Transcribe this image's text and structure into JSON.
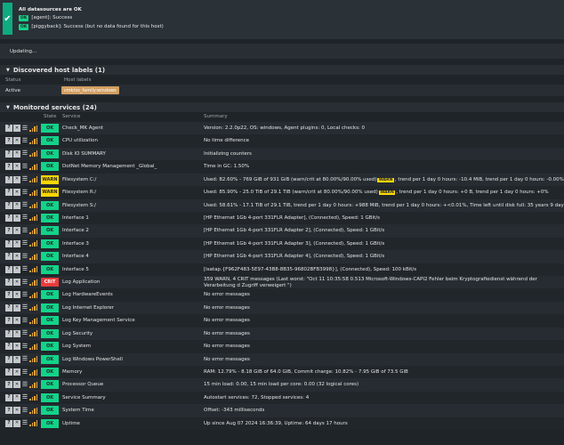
{
  "status": {
    "title": "All datasources are OK",
    "lines": [
      {
        "badge": "OK",
        "text": "[agent]: Success"
      },
      {
        "badge": "OK",
        "text": "[piggyback]: Success (but no data found for this host)"
      }
    ]
  },
  "updating": "Updating...",
  "host_labels": {
    "header": "Discovered host labels (1)",
    "col_status": "Status",
    "col_labels": "Host labels",
    "active": "Active",
    "label": "cmk/os_family:windows"
  },
  "services": {
    "header": "Monitored services (24)",
    "col_state": "State",
    "col_service": "Service",
    "col_summary": "Summary",
    "rows": [
      {
        "state": "OK",
        "name": "Check_MK Agent",
        "summary": "Version: 2.2.0p22, OS: windows, Agent plugins: 0, Local checks: 0"
      },
      {
        "state": "OK",
        "name": "CPU utilization",
        "summary": "No time difference"
      },
      {
        "state": "OK",
        "name": "Disk IO SUMMARY",
        "summary": "Initializing counters"
      },
      {
        "state": "OK",
        "name": "DotNet Memory Management _Global_",
        "summary": "Time in GC: 1.50%"
      },
      {
        "state": "WARN",
        "name": "Filesystem C:/",
        "summary_a": "Used: 82.60% - 769 GiB of 931 GiB (warn/crit at 80.00%/90.00% used)",
        "inline": "WARN",
        "summary_b": ", trend per 1 day 0 hours: -10.4 MiB, trend per 1 day 0 hours: -0.00%"
      },
      {
        "state": "WARN",
        "name": "Filesystem R:/",
        "summary_a": "Used: 85.90% - 25.0 TiB of 29.1 TiB (warn/crit at 80.00%/90.00% used)",
        "inline": "WARN",
        "summary_b": ", trend per 1 day 0 hours: +0 B, trend per 1 day 0 hours: +0%"
      },
      {
        "state": "OK",
        "name": "Filesystem S:/",
        "summary": "Used: 58.61% - 17.1 TiB of 29.1 TiB, trend per 1 day 0 hours: +988 MiB, trend per 1 day 0 hours: +<0.01%, Time left until disk full: 35 years 9 days"
      },
      {
        "state": "OK",
        "name": "Interface 1",
        "summary": "[HP Ethernet 1Gb 4-port 331FLR Adapter], (Connected), Speed: 1 GBit/s"
      },
      {
        "state": "OK",
        "name": "Interface 2",
        "summary": "[HP Ethernet 1Gb 4-port 331FLR Adapter 2], (Connected), Speed: 1 GBit/s"
      },
      {
        "state": "OK",
        "name": "Interface 3",
        "summary": "[HP Ethernet 1Gb 4-port 331FLR Adapter 3], (Connected), Speed: 1 GBit/s"
      },
      {
        "state": "OK",
        "name": "Interface 4",
        "summary": "[HP Ethernet 1Gb 4-port 331FLR Adapter 4], (Connected), Speed: 1 GBit/s"
      },
      {
        "state": "OK",
        "name": "Interface 5",
        "summary": "[isatap.{F962F483-5E97-43B8-8B35-96802BFB3998}], (Connected), Speed: 100 kBit/s"
      },
      {
        "state": "CRIT",
        "name": "Log Application",
        "summary": "359 WARN, 4 CRIT messages (Last worst: \"Oct 11 10:35:58 0.513 Microsoft-Windows-CAPI2 Fehler beim Kryptografiedienst während der Verarbeitung d Zugriff verweigert \")",
        "two_line": true
      },
      {
        "state": "OK",
        "name": "Log HardwareEvents",
        "summary": "No error messages"
      },
      {
        "state": "OK",
        "name": "Log Internet Explorer",
        "summary": "No error messages"
      },
      {
        "state": "OK",
        "name": "Log Key Management Service",
        "summary": "No error messages"
      },
      {
        "state": "OK",
        "name": "Log Security",
        "summary": "No error messages"
      },
      {
        "state": "OK",
        "name": "Log System",
        "summary": "No error messages"
      },
      {
        "state": "OK",
        "name": "Log Windows PowerShell",
        "summary": "No error messages"
      },
      {
        "state": "OK",
        "name": "Memory",
        "summary": "RAM: 12.79% - 8.18 GiB of 64.0 GiB, Commit charge: 10.82% - 7.95 GiB of 73.5 GiB"
      },
      {
        "state": "OK",
        "name": "Processor Queue",
        "summary": "15 min load: 0.00, 15 min load per core: 0.00 (32 logical cores)"
      },
      {
        "state": "OK",
        "name": "Service Summary",
        "summary": "Autostart services: 72, Stopped services: 4"
      },
      {
        "state": "OK",
        "name": "System Time",
        "summary": "Offset: -343 milliseconds"
      },
      {
        "state": "OK",
        "name": "Uptime",
        "summary": "Up since Aug 07 2024 16:36:39, Uptime: 64 days 17 hours"
      }
    ]
  },
  "colors": {
    "ok": "#13d389",
    "warn": "#ffd703",
    "crit": "#ea3c3d",
    "label": "#d39f62",
    "bg": "#1f2429"
  },
  "icons": [
    "checkmark-icon",
    "help-icon",
    "disable-icon",
    "menu-icon",
    "perfgraph-icon",
    "collapse-triangle-icon"
  ]
}
